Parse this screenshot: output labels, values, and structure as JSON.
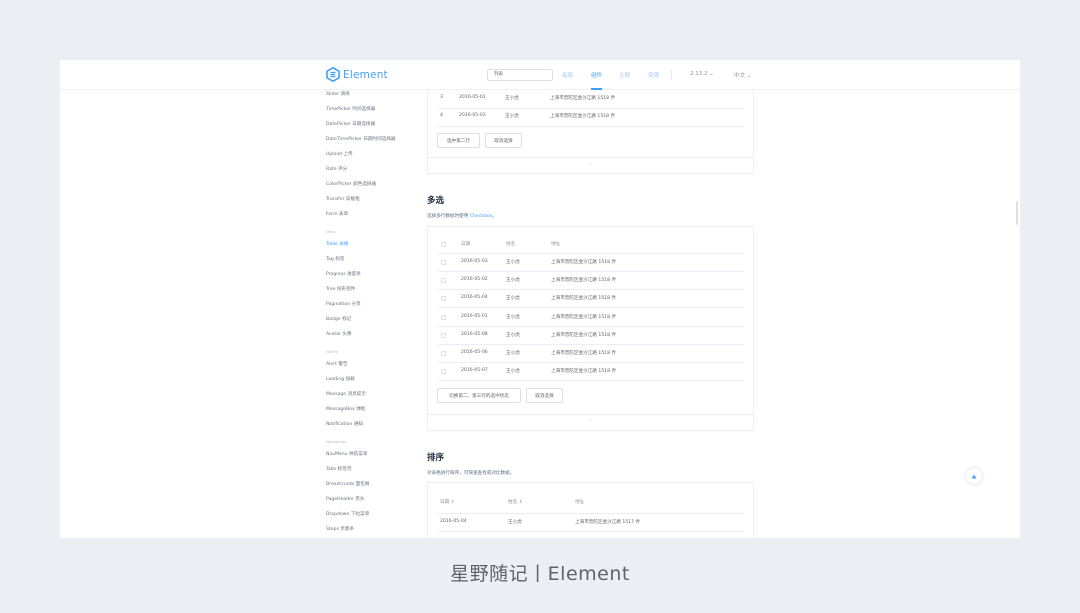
{
  "header": {
    "logo_text": "Element",
    "search_placeholder": "列表",
    "nav": [
      "指南",
      "组件",
      "主题",
      "资源"
    ],
    "active_nav": "组件",
    "version": "2.13.2",
    "language": "中文"
  },
  "sidebar": {
    "items_top": [
      "Slider 滑块",
      "TimePicker 时间选择器",
      "DatePicker 日期选择器",
      "DateTimePicker 日期时间选择器",
      "Upload 上传",
      "Rate 评分",
      "ColorPicker 颜色选择器",
      "Transfer 穿梭框",
      "Form 表单"
    ],
    "group_data": "Data",
    "items_data": [
      "Table 表格",
      "Tag 标签",
      "Progress 进度条",
      "Tree 树形控件",
      "Pagination 分页",
      "Badge 标记",
      "Avatar 头像"
    ],
    "active_item": "Table 表格",
    "group_notice": "Notice",
    "items_notice": [
      "Alert 警告",
      "Loading 加载",
      "Message 消息提示",
      "MessageBox 弹框",
      "Notification 通知"
    ],
    "group_nav": "Navigation",
    "items_nav": [
      "NavMenu 导航菜单",
      "Tabs 标签页",
      "Breadcrumb 面包屑",
      "PageHeader 页头",
      "Dropdown 下拉菜单",
      "Steps 步骤条"
    ]
  },
  "single_select": {
    "rows": [
      {
        "index": "3",
        "date": "2016-05-01",
        "name": "王小虎",
        "address": "上海市普陀区金沙江路 1518 弄"
      },
      {
        "index": "4",
        "date": "2016-05-03",
        "name": "王小虎",
        "address": "上海市普陀区金沙江路 1518 弄"
      }
    ],
    "buttons": [
      "选中第二行",
      "取消选择"
    ]
  },
  "multi_select": {
    "title": "多选",
    "desc_prefix": "选择多行数据时使用 ",
    "desc_highlight": "Checkbox",
    "desc_suffix": "。",
    "headers": [
      "日期",
      "姓名",
      "地址"
    ],
    "rows": [
      {
        "date": "2016-05-03",
        "name": "王小虎",
        "address": "上海市普陀区金沙江路 1518 弄"
      },
      {
        "date": "2016-05-02",
        "name": "王小虎",
        "address": "上海市普陀区金沙江路 1518 弄"
      },
      {
        "date": "2016-05-04",
        "name": "王小虎",
        "address": "上海市普陀区金沙江路 1518 弄"
      },
      {
        "date": "2016-05-01",
        "name": "王小虎",
        "address": "上海市普陀区金沙江路 1518 弄"
      },
      {
        "date": "2016-05-08",
        "name": "王小虎",
        "address": "上海市普陀区金沙江路 1518 弄"
      },
      {
        "date": "2016-05-06",
        "name": "王小虎",
        "address": "上海市普陀区金沙江路 1518 弄"
      },
      {
        "date": "2016-05-07",
        "name": "王小虎",
        "address": "上海市普陀区金沙江路 1518 弄"
      }
    ],
    "buttons": [
      "切换第二、第三行的选中状态",
      "取消选择"
    ]
  },
  "sorting": {
    "title": "排序",
    "desc": "对表格进行排序，可快速查找或对比数据。",
    "headers": [
      "日期",
      "姓名",
      "地址"
    ],
    "rows": [
      {
        "date": "2016-05-04",
        "name": "王小虎",
        "address": "上海市普陀区金沙江路 1517 弄"
      }
    ]
  },
  "caption": "星野随记丨Element",
  "colors": {
    "accent": "#409eff",
    "text": "#606266",
    "border": "#ebeef5",
    "background": "#eceef3"
  }
}
